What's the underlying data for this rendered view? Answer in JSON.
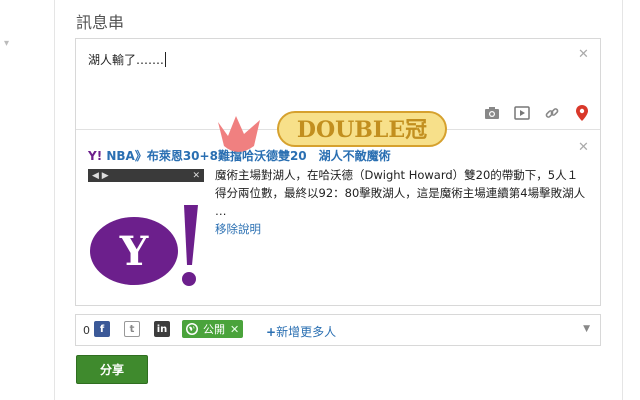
{
  "stream": {
    "title": "訊息串"
  },
  "composer": {
    "text": "湖人輸了…….",
    "link_preview": {
      "source_mark": "Y!",
      "title": "NBA》布萊恩30+8難擋哈沃德雙20　湖人不敵魔術",
      "description": "魔術主場對湖人，在哈沃德（Dwight Howard）雙20的帶動下，5人１得分兩位數，最終以92：80擊敗湖人，這是魔術主場連續第4場擊敗湖人 …",
      "remove_label": "移除說明",
      "thumb_nav": {
        "prev": "◀",
        "next": "▶",
        "close": "✕"
      },
      "logo_text": "Y!"
    },
    "media_icons": [
      "camera-icon",
      "video-icon",
      "link-icon",
      "location-pin-icon"
    ]
  },
  "share_settings": {
    "count": "0",
    "social": [
      {
        "name": "facebook",
        "glyph": "f"
      },
      {
        "name": "twitter",
        "glyph": "t"
      },
      {
        "name": "linkedin",
        "glyph": "in"
      }
    ],
    "audience_chip": "公開",
    "add_more": "新增更多人",
    "plus": "+"
  },
  "share_button": {
    "label": "分享"
  },
  "watermark": {
    "text": "DOUBLE冠"
  },
  "colors": {
    "accent_green": "#3f8a2d",
    "link_blue": "#2a6fb2",
    "yahoo_purple": "#6c1f8c",
    "watermark_pink": "#f08080",
    "watermark_gold": "#e3b43c"
  }
}
